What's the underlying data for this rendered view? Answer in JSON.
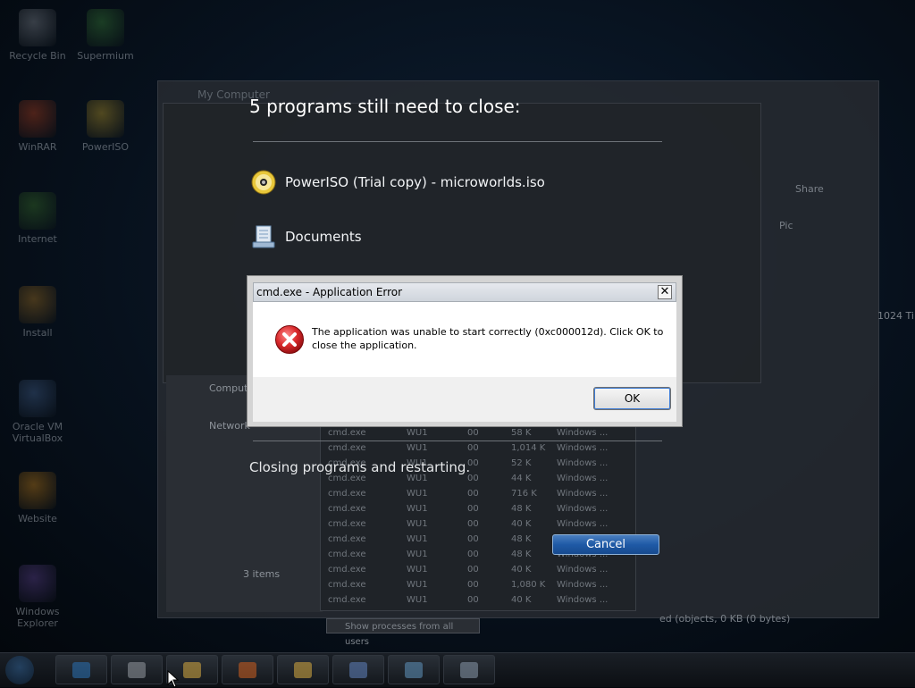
{
  "desktop_icons": [
    {
      "label": "Recycle Bin",
      "icon": "recycle-bin-icon",
      "color": "#8a9099"
    },
    {
      "label": "Supermium",
      "icon": "browser-icon",
      "color": "#3e8a3a"
    },
    {
      "label": "WinRAR",
      "icon": "archive-icon",
      "color": "#c2441e"
    },
    {
      "label": "PowerISO",
      "icon": "disc-icon",
      "color": "#c9a52a"
    },
    {
      "label": "Internet",
      "icon": "globe-icon",
      "color": "#3e7a2a"
    },
    {
      "label": "Install",
      "icon": "installer-icon",
      "color": "#b07a22"
    },
    {
      "label": "Oracle VM VirtualBox",
      "icon": "virtualbox-icon",
      "color": "#4a6a9a"
    },
    {
      "label": "Website",
      "icon": "website-icon",
      "color": "#d48a18"
    },
    {
      "label": "Windows Explorer",
      "icon": "explorer-icon",
      "color": "#6a4aa0"
    }
  ],
  "restart_overlay": {
    "title": "5 programs still need to close:",
    "programs": [
      {
        "name": "PowerISO (Trial copy) - microworlds.iso",
        "icon": "disc-icon"
      },
      {
        "name": "Documents",
        "icon": "documents-icon"
      }
    ],
    "status": "Closing programs and restarting.",
    "cancel_label": "Cancel"
  },
  "error_dialog": {
    "title": "cmd.exe - Application Error",
    "close_glyph": "✕",
    "message": "The application was unable to start correctly (0xc000012d). Click OK to close the application.",
    "ok_label": "OK",
    "icon": "error-icon",
    "icon_color": "#d8282a"
  },
  "background": {
    "explorer_title": "My Computer",
    "sidebar_items": [
      "Computer",
      "Network"
    ],
    "items_count": "3 items",
    "task_manager_rows": [
      {
        "name": "cmd.exe",
        "user": "WU1",
        "cpu": "00",
        "mem": "58 K",
        "desc": "Windows ..."
      },
      {
        "name": "cmd.exe",
        "user": "WU1",
        "cpu": "00",
        "mem": "1,014 K",
        "desc": "Windows ..."
      },
      {
        "name": "cmd.exe",
        "user": "WU1",
        "cpu": "00",
        "mem": "52 K",
        "desc": "Windows ..."
      },
      {
        "name": "cmd.exe",
        "user": "WU1",
        "cpu": "00",
        "mem": "44 K",
        "desc": "Windows ..."
      },
      {
        "name": "cmd.exe",
        "user": "WU1",
        "cpu": "00",
        "mem": "716 K",
        "desc": "Windows ..."
      },
      {
        "name": "cmd.exe",
        "user": "WU1",
        "cpu": "00",
        "mem": "48 K",
        "desc": "Windows ..."
      },
      {
        "name": "cmd.exe",
        "user": "WU1",
        "cpu": "00",
        "mem": "40 K",
        "desc": "Windows ..."
      },
      {
        "name": "cmd.exe",
        "user": "WU1",
        "cpu": "00",
        "mem": "48 K",
        "desc": "Windows ..."
      },
      {
        "name": "cmd.exe",
        "user": "WU1",
        "cpu": "00",
        "mem": "48 K",
        "desc": "Windows ..."
      },
      {
        "name": "cmd.exe",
        "user": "WU1",
        "cpu": "00",
        "mem": "40 K",
        "desc": "Windows ..."
      },
      {
        "name": "cmd.exe",
        "user": "WU1",
        "cpu": "00",
        "mem": "1,080 K",
        "desc": "Windows ..."
      },
      {
        "name": "cmd.exe",
        "user": "WU1",
        "cpu": "00",
        "mem": "40 K",
        "desc": "Windows ..."
      }
    ],
    "show_processes_label": "Show processes from all users",
    "right_texts": [
      "Share",
      "Pic",
      "1024 Ti"
    ],
    "status_text": "ed (objects, 0 KB (0 bytes)"
  },
  "taskbar": {
    "buttons": [
      {
        "icon": "ie-icon",
        "color": "#2a6aa8"
      },
      {
        "icon": "notepad-icon",
        "color": "#8a8f96"
      },
      {
        "icon": "folder-icon",
        "color": "#c8a040"
      },
      {
        "icon": "media-icon",
        "color": "#c05a20"
      },
      {
        "icon": "explorer-icon",
        "color": "#c8a040"
      },
      {
        "icon": "computer-icon",
        "color": "#5a7ab0"
      },
      {
        "icon": "taskmgr-icon",
        "color": "#5a8ab0"
      },
      {
        "icon": "window-icon",
        "color": "#8090a0"
      }
    ]
  }
}
